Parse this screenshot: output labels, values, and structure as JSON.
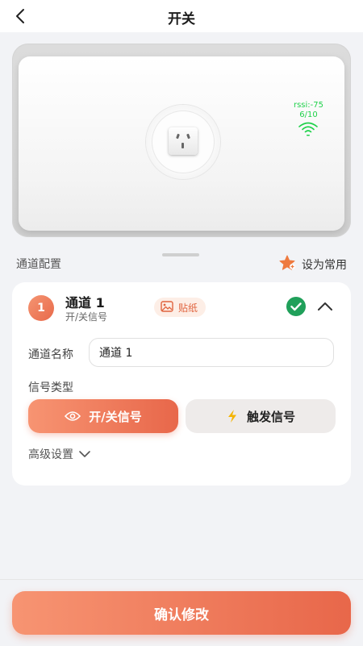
{
  "header": {
    "title": "开关"
  },
  "device": {
    "rssi": "rssi:-75",
    "signal_level": "6/10"
  },
  "section": {
    "title": "通道配置",
    "favorite_label": "设为常用"
  },
  "channel": {
    "number": "1",
    "name": "通道 1",
    "subtitle": "开/关信号",
    "sticker_label": "贴纸",
    "name_field_label": "通道名称",
    "name_value": "通道 1",
    "signal_type_label": "信号类型",
    "signal_options": [
      "开/关信号",
      "触发信号"
    ],
    "selected_signal": "开/关信号",
    "advanced_label": "高级设置"
  },
  "footer": {
    "confirm_label": "确认修改"
  },
  "colors": {
    "accent": "#e8694a",
    "success": "#20a05a",
    "rssi": "#1fd14a"
  }
}
